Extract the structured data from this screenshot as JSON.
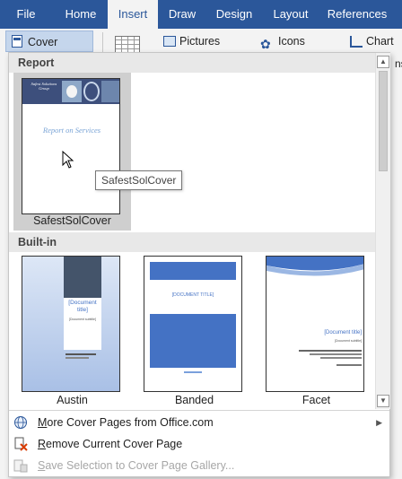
{
  "ribbon": {
    "tabs": [
      {
        "label": "File"
      },
      {
        "label": "Home"
      },
      {
        "label": "Insert"
      },
      {
        "label": "Draw"
      },
      {
        "label": "Design"
      },
      {
        "label": "Layout"
      },
      {
        "label": "References"
      }
    ],
    "cover_page_label": "Cover Page",
    "pictures_label": "Pictures",
    "icons_label": "Icons",
    "chart_label": "Chart",
    "overflow_text": "ns"
  },
  "gallery": {
    "sections": [
      {
        "title": "Report",
        "items": [
          {
            "label": "SafestSolCover",
            "logo_text": "Safest Solutions Group",
            "cover_title": "Report on Services"
          }
        ]
      },
      {
        "title": "Built-in",
        "items": [
          {
            "label": "Austin",
            "title_text": "[Document title]",
            "subtitle_text": "[Document subtitle]"
          },
          {
            "label": "Banded",
            "title_text": "[DOCUMENT TITLE]"
          },
          {
            "label": "Facet",
            "title_text": "[Document title]",
            "subtitle_text": "[Document subtitle]"
          }
        ]
      }
    ]
  },
  "menu": {
    "more_prefix": "M",
    "more_rest": "ore Cover Pages from Office.com",
    "remove_prefix": "R",
    "remove_rest": "emove Current Cover Page",
    "save_prefix": "S",
    "save_rest": "ave Selection to Cover Page Gallery..."
  },
  "tooltip": "SafestSolCover",
  "colors": {
    "ribbon_blue": "#2b579a",
    "selection": "#cfcfcf",
    "cover_blue": "#4472c4"
  }
}
